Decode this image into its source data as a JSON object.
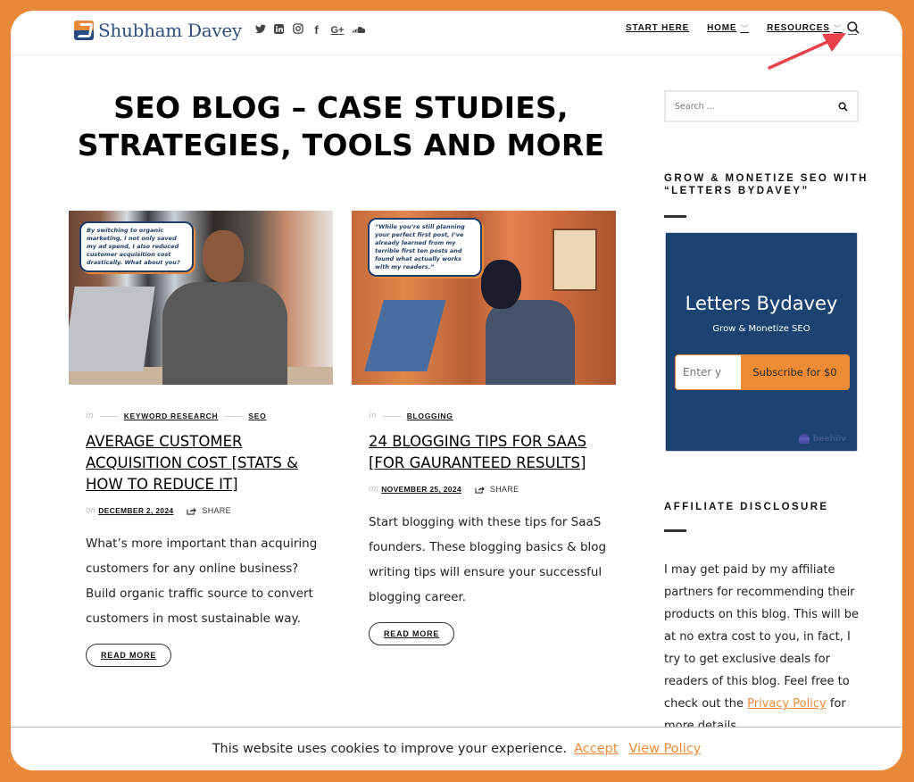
{
  "header": {
    "site_name": "Shubham Davey",
    "social_icons": [
      {
        "name": "twitter-icon",
        "glyph": "🐦︎"
      },
      {
        "name": "linkedin-icon",
        "glyph": "in"
      },
      {
        "name": "instagram-icon",
        "glyph": "◎"
      },
      {
        "name": "facebook-icon",
        "glyph": "f"
      },
      {
        "name": "google-plus-icon",
        "glyph": "G+"
      },
      {
        "name": "soundcloud-icon",
        "glyph": "☁"
      }
    ],
    "nav": {
      "start_here": "START HERE",
      "home": "HOME",
      "resources": "RESOURCES"
    },
    "annotation_color": "#e8434b"
  },
  "main": {
    "page_title": "SEO BLOG – CASE STUDIES, STRATEGIES, TOOLS AND MORE",
    "in_label": "in",
    "on_label": "on",
    "share_label": "SHARE",
    "read_more_label": "READ MORE",
    "posts": [
      {
        "image_caption": "By switching to organic marketing, I not only saved my ad spend, I also reduced customer acquisition cost drastically. What about you?",
        "categories": [
          "KEYWORD RESEARCH",
          "SEO"
        ],
        "title": "AVERAGE CUSTOMER ACQUISITION COST [STATS & HOW TO REDUCE IT]",
        "date": "DECEMBER 2, 2024",
        "excerpt": "What’s more important than acquiring customers for any online business? Build organic traffic source to convert customers in most sustainable way."
      },
      {
        "image_caption": "“While you’re still planning your perfect first post, I’ve already learned from my terrible first ten posts and found what actually works with my readers.”",
        "categories": [
          "BLOGGING"
        ],
        "title": "24 BLOGGING TIPS FOR SAAS [FOR GAURANTEED RESULTS]",
        "date": "NOVEMBER 25, 2024",
        "excerpt": "Start blogging with these tips for SaaS founders. These blogging basics & blog writing tips will ensure your successful blogging career."
      }
    ]
  },
  "sidebar": {
    "search_placeholder": "Search ...",
    "newsletter_widget_title": "GROW & MONETIZE SEO WITH “LETTERS BYDAVEY”",
    "newsletter": {
      "title": "Letters Bydavey",
      "subtitle": "Grow & Monetize SEO",
      "email_placeholder": "Enter your email",
      "email_value_visible": "Enter y",
      "subscribe_label": "Subscribe for $0",
      "powered_by": "beehiiv",
      "bg_color": "#1c4272",
      "button_color": "#ee8c35"
    },
    "affiliate_title": "AFFILIATE DISCLOSURE",
    "affiliate_text_before": "I may get paid by my affiliate partners for recommending their products on this blog. This will be at no extra cost to you, in fact, I try to get exclusive deals for readers of this blog. Feel free to check out the ",
    "affiliate_link": "Privacy Policy",
    "affiliate_text_after": " for more details."
  },
  "cookie_bar": {
    "message": "This website uses cookies to improve your experience.",
    "accept_label": "Accept",
    "policy_label": "View Policy"
  },
  "colors": {
    "frame_bg": "#e8893a",
    "accent": "#ee8c35",
    "brand_blue": "#2f4d7d"
  }
}
